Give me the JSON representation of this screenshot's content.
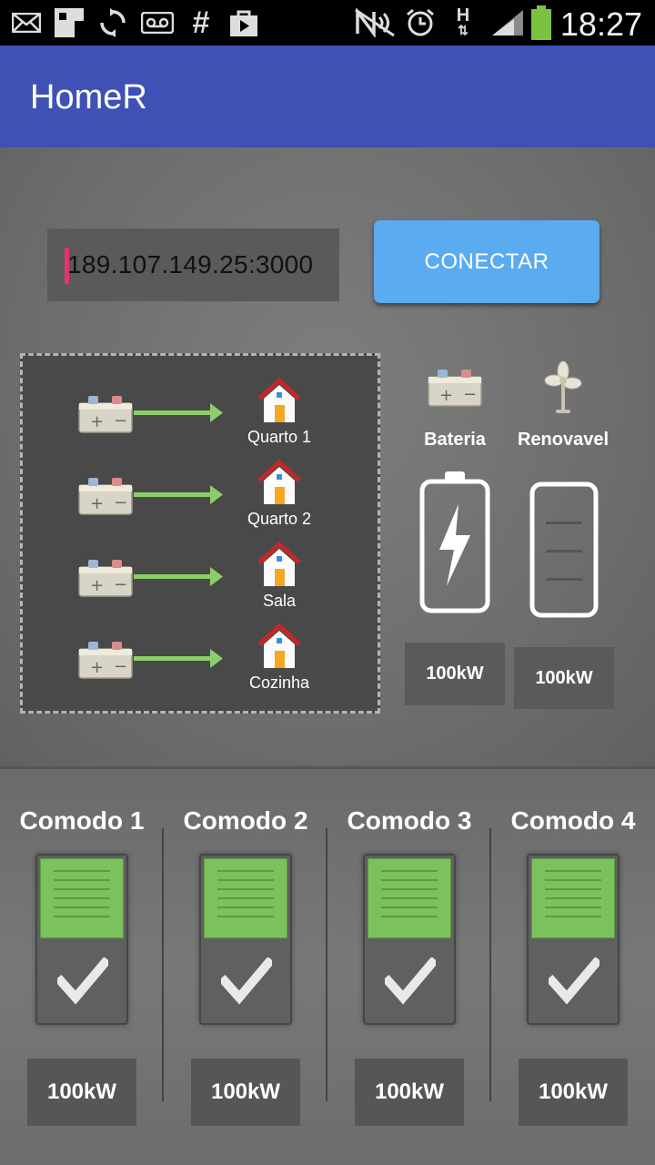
{
  "status_bar": {
    "time": "18:27",
    "icons": [
      "mail-icon",
      "image-icon",
      "sync-icon",
      "voicemail-icon",
      "hash-icon",
      "shop-icon",
      "nfc-icon",
      "alarm-icon",
      "hspa-icon",
      "signal-icon",
      "battery-icon"
    ]
  },
  "app": {
    "title": "HomeR"
  },
  "connection": {
    "ip_value": "189.107.149.25:3000",
    "connect_label": "CONECTAR"
  },
  "schema": {
    "rooms": [
      {
        "label": "Quarto 1"
      },
      {
        "label": "Quarto 2"
      },
      {
        "label": "Sala"
      },
      {
        "label": "Cozinha"
      }
    ]
  },
  "sources": {
    "battery": {
      "label": "Bateria",
      "value": "100kW"
    },
    "renewable": {
      "label": "Renovavel",
      "value": "100kW"
    }
  },
  "comodos": [
    {
      "title": "Comodo 1",
      "value": "100kW"
    },
    {
      "title": "Comodo 2",
      "value": "100kW"
    },
    {
      "title": "Comodo 3",
      "value": "100kW"
    },
    {
      "title": "Comodo 4",
      "value": "100kW"
    }
  ],
  "colors": {
    "appbar": "#3f51b5",
    "connect": "#5aabf0",
    "switch_on": "#7bc15d",
    "cursor": "#e8336a"
  }
}
